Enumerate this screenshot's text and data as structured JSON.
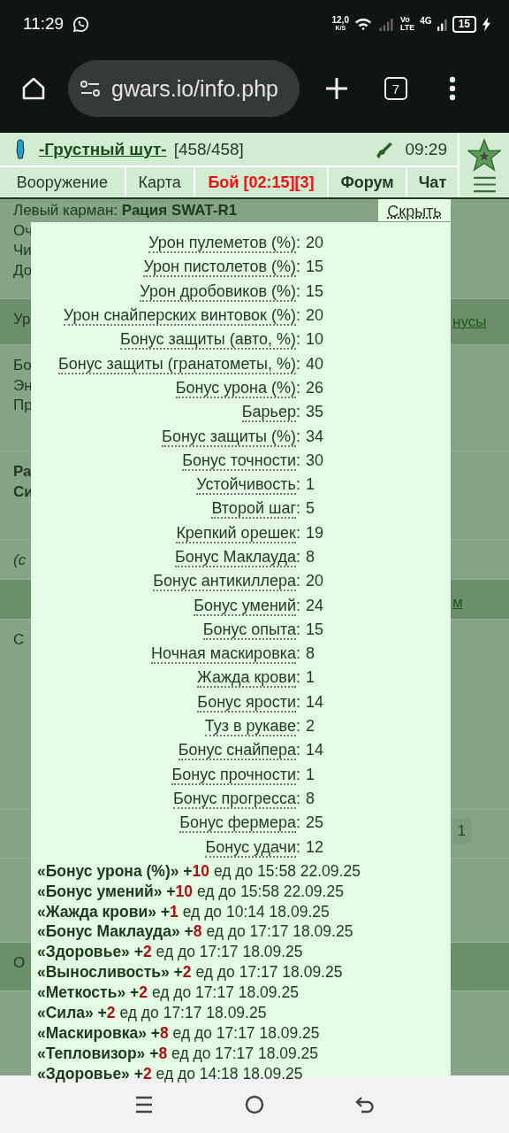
{
  "status_bar": {
    "time": "11:29",
    "speed": "12,0",
    "speed_unit": "K/S",
    "volte_top": "Vo",
    "volte_bottom": "LTE",
    "network": "4G",
    "battery": "15"
  },
  "browser": {
    "url": "gwars.io/info.php",
    "tab_count": "7"
  },
  "header": {
    "player": "-Грустный шут-",
    "hp": "[458/458]",
    "clock": "09:29"
  },
  "tabs": [
    {
      "label": "Вооружение",
      "kind": "plain"
    },
    {
      "label": "Карта",
      "kind": "plain"
    },
    {
      "label": "Бой [02:15][3]",
      "kind": "alert"
    },
    {
      "label": "Форум",
      "kind": "bold"
    },
    {
      "label": "Чат",
      "kind": "bold"
    }
  ],
  "background": [
    {
      "kind": "plain",
      "lines": [
        "Левый карман: **Рация SWAT-R1**",
        "Оч",
        "Чи",
        "До"
      ]
    },
    {
      "kind": "plain",
      "shaded": true,
      "lines": [
        "Ур"
      ],
      "link": "нусы"
    },
    {
      "kind": "plain",
      "lines": [
        "Бо",
        "Эн",
        "Пр"
      ]
    },
    {
      "kind": "bold",
      "lines": [
        "Ра",
        "Си"
      ]
    },
    {
      "kind": "italic",
      "lines": [
        "(с"
      ]
    },
    {
      "kind": "plain",
      "shaded": true,
      "link": "м"
    },
    {
      "kind": "plain",
      "lines": [
        "С"
      ]
    },
    {
      "kind": "plain",
      "tag": "1"
    },
    {
      "kind": "plain"
    },
    {
      "kind": "plain",
      "shaded": true,
      "lines": [
        "О"
      ]
    }
  ],
  "popup": {
    "hide": "Скрыть",
    "stats": [
      {
        "label": "Урон пулеметов (%)",
        "sep": ":",
        "value": "20"
      },
      {
        "label": "Урон пистолетов (%)",
        "sep": ":",
        "value": "15"
      },
      {
        "label": "Урон дробовиков (%)",
        "sep": ":",
        "value": "15"
      },
      {
        "label": "Урон снайперских винтовок (%)",
        "sep": ":",
        "value": "20"
      },
      {
        "label": "Бонус защиты (авто, %)",
        "sep": ":",
        "value": "10"
      },
      {
        "label": "Бонус защиты (гранатометы, %)",
        "sep": ":",
        "value": "40"
      },
      {
        "label": "Бонус урона (%)",
        "sep": ":",
        "value": "26"
      },
      {
        "label": "Барьер",
        "sep": ":",
        "value": "35"
      },
      {
        "label": "Бонус защиты (%)",
        "sep": ":",
        "value": "34"
      },
      {
        "label": "Бонус точности",
        "sep": ":",
        "value": "30"
      },
      {
        "label": "Устойчивость",
        "sep": ":",
        "value": "1"
      },
      {
        "label": "Второй шаг",
        "sep": ":",
        "value": "5"
      },
      {
        "label": "Крепкий орешек",
        "sep": ":",
        "value": "19"
      },
      {
        "label": "Бонус Маклауда",
        "sep": ":",
        "value": "8"
      },
      {
        "label": "Бонус антикиллера",
        "sep": ":",
        "value": "20"
      },
      {
        "label": "Бонус умений",
        "sep": ":",
        "value": "24"
      },
      {
        "label": "Бонус опыта",
        "sep": ":",
        "value": "15"
      },
      {
        "label": "Ночная маскировка",
        "sep": ":",
        "value": "8"
      },
      {
        "label": "Жажда крови",
        "sep": ":",
        "value": "1"
      },
      {
        "label": "Бонус ярости",
        "sep": ":",
        "value": "14"
      },
      {
        "label": "Туз в рукаве",
        "sep": ":",
        "value": "2"
      },
      {
        "label": "Бонус снайпера",
        "sep": ":",
        "value": "14"
      },
      {
        "label": "Бонус прочности",
        "sep": ":",
        "value": "1"
      },
      {
        "label": "Бонус прогресса",
        "sep": ":",
        "value": "8"
      },
      {
        "label": "Бонус фермера",
        "sep": ":",
        "value": "25"
      },
      {
        "label": "Бонус удачи",
        "sep": ":",
        "value": "12"
      }
    ],
    "bonuses": [
      {
        "name": "«Бонус урона (%)»",
        "sign": "+",
        "amount": "10",
        "until": "ед до 15:58 22.09.25"
      },
      {
        "name": "«Бонус умений»",
        "sign": "+",
        "amount": "10",
        "until": "ед до 15:58 22.09.25"
      },
      {
        "name": "«Жажда крови»",
        "sign": "+",
        "amount": "1",
        "until": "ед до 10:14 18.09.25"
      },
      {
        "name": "«Бонус Маклауда»",
        "sign": "+",
        "amount": "8",
        "until": "ед до 17:17 18.09.25"
      },
      {
        "name": "«Здоровье»",
        "sign": "+",
        "amount": "2",
        "until": "ед до 17:17 18.09.25"
      },
      {
        "name": "«Выносливость»",
        "sign": "+",
        "amount": "2",
        "until": "ед до 17:17 18.09.25"
      },
      {
        "name": "«Меткость»",
        "sign": "+",
        "amount": "2",
        "until": "ед до 17:17 18.09.25"
      },
      {
        "name": "«Сила»",
        "sign": "+",
        "amount": "2",
        "until": "ед до 17:17 18.09.25"
      },
      {
        "name": "«Маскировка»",
        "sign": "+",
        "amount": "8",
        "until": "ед до 17:17 18.09.25"
      },
      {
        "name": "«Тепловизор»",
        "sign": "+",
        "amount": "8",
        "until": "ед до 17:17 18.09.25"
      },
      {
        "name": "«Здоровье»",
        "sign": "+",
        "amount": "2",
        "until": "ед до 14:18 18.09.25"
      }
    ]
  }
}
